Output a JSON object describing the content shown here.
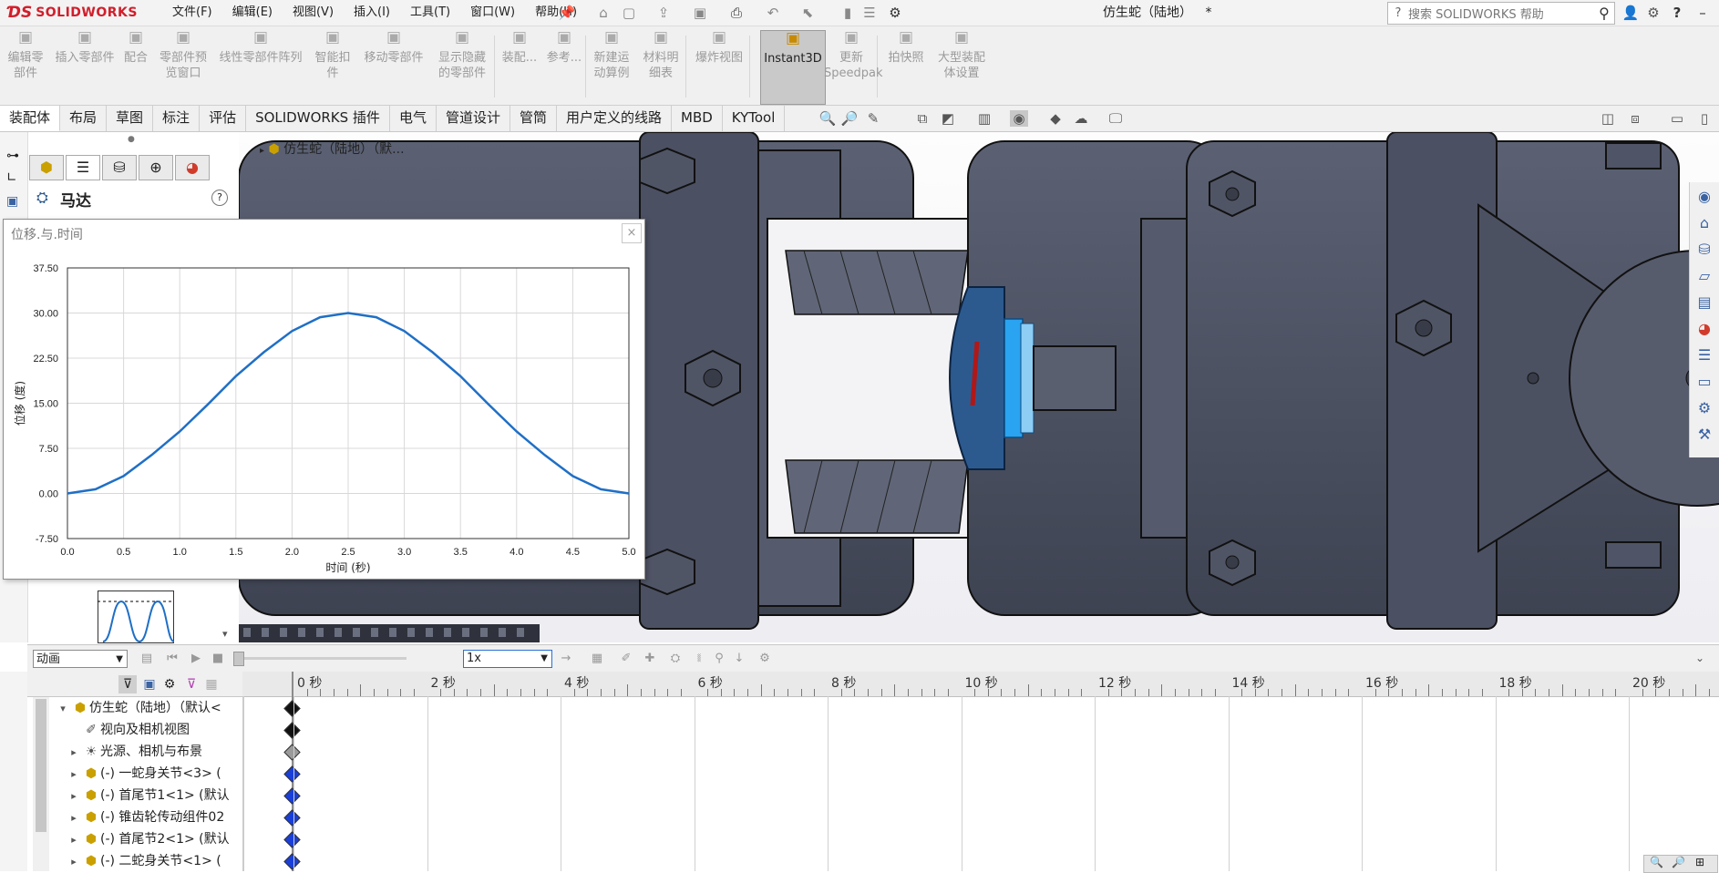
{
  "app": {
    "brand": "SOLIDWORKS",
    "document_title": "仿生蛇（陆地）",
    "modified_marker": "*",
    "menus": [
      "文件(F)",
      "编辑(E)",
      "视图(V)",
      "插入(I)",
      "工具(T)",
      "窗口(W)",
      "帮助(H)"
    ],
    "search_placeholder": "搜索 SOLIDWORKS 帮助"
  },
  "command_manager": [
    {
      "label": "编辑零\n部件",
      "icon": "edit-component-icon",
      "enabled": false
    },
    {
      "label": "插入零部件",
      "icon": "insert-component-icon",
      "enabled": false
    },
    {
      "label": "配合",
      "icon": "mate-icon",
      "enabled": false
    },
    {
      "label": "零部件预\n览窗口",
      "icon": "preview-window-icon",
      "enabled": false
    },
    {
      "label": "线性零部件阵列",
      "icon": "pattern-icon",
      "enabled": false
    },
    {
      "label": "智能扣\n件",
      "icon": "smart-fastener-icon",
      "enabled": false
    },
    {
      "label": "移动零部件",
      "icon": "move-component-icon",
      "enabled": false
    },
    {
      "label": "显示隐藏\n的零部件",
      "icon": "show-hidden-icon",
      "enabled": false
    },
    {
      "label": "装配...",
      "icon": "assembly-feature-icon",
      "enabled": false
    },
    {
      "label": "参考...",
      "icon": "reference-geometry-icon",
      "enabled": false
    },
    {
      "label": "新建运\n动算例",
      "icon": "new-motion-study-icon",
      "enabled": false
    },
    {
      "label": "材料明\n细表",
      "icon": "bom-icon",
      "enabled": false
    },
    {
      "label": "爆炸视图",
      "icon": "exploded-view-icon",
      "enabled": false
    },
    {
      "label": "Instant3D",
      "icon": "instant3d-icon",
      "enabled": true
    },
    {
      "label": "更新\nSpeedpak",
      "icon": "speedpak-icon",
      "enabled": false
    },
    {
      "label": "拍快照",
      "icon": "snapshot-icon",
      "enabled": false
    },
    {
      "label": "大型装配\n体设置",
      "icon": "large-assembly-icon",
      "enabled": false
    }
  ],
  "tabs": [
    "装配体",
    "布局",
    "草图",
    "标注",
    "评估",
    "SOLIDWORKS 插件",
    "电气",
    "管道设计",
    "管筒",
    "用户定义的线路",
    "MBD",
    "KYTool"
  ],
  "property_manager": {
    "title": "马达",
    "help": "?"
  },
  "feature_tree_head": "仿生蛇（陆地）（默...",
  "graph": {
    "window_title": "位移.与.时间",
    "close": "×"
  },
  "chart_data": {
    "type": "line",
    "xlabel": "时间 (秒)",
    "ylabel": "位移 (度)",
    "xlim": [
      0.0,
      5.0
    ],
    "ylim": [
      -7.5,
      37.5
    ],
    "x_ticks": [
      "0.0",
      "0.5",
      "1.0",
      "1.5",
      "2.0",
      "2.5",
      "3.0",
      "3.5",
      "4.0",
      "4.5",
      "5.0"
    ],
    "y_ticks": [
      "37.50",
      "30.00",
      "22.50",
      "15.00",
      "7.50",
      "0.00",
      "-7.50"
    ],
    "grid": true,
    "line_color": "#1f6fc6",
    "x": [
      0,
      0.25,
      0.5,
      0.75,
      1.0,
      1.25,
      1.5,
      1.75,
      2.0,
      2.25,
      2.5,
      2.75,
      3.0,
      3.25,
      3.5,
      3.75,
      4.0,
      4.25,
      4.5,
      4.75,
      5.0
    ],
    "y": [
      0.0,
      0.7,
      2.9,
      6.4,
      10.3,
      14.8,
      19.5,
      23.5,
      27.0,
      29.3,
      30.0,
      29.3,
      27.0,
      23.5,
      19.5,
      14.8,
      10.3,
      6.4,
      2.9,
      0.7,
      0.0
    ]
  },
  "motion_manager": {
    "study_type": "动画",
    "playback_speed": "1x",
    "time_labels": [
      "0 秒",
      "2 秒",
      "4 秒",
      "6 秒",
      "8 秒",
      "10 秒",
      "12 秒",
      "14 秒",
      "16 秒",
      "18 秒",
      "20 秒"
    ],
    "tree": [
      {
        "label": "仿生蛇（陆地）（默认<",
        "expand": "▾",
        "icon": "assembly-icon",
        "key_color": "#111111"
      },
      {
        "label": "视向及相机视图",
        "expand": "",
        "icon": "camera-view-icon",
        "key_color": "#111111"
      },
      {
        "label": "光源、相机与布景",
        "expand": "▸",
        "icon": "lights-icon",
        "key_color": "#9a9a9a"
      },
      {
        "label": "(-) 一蛇身关节<3> (",
        "expand": "▸",
        "icon": "subassembly-icon",
        "key_color": "#1a3fd8"
      },
      {
        "label": "(-) 首尾节1<1> (默认",
        "expand": "▸",
        "icon": "subassembly-icon",
        "key_color": "#1a3fd8"
      },
      {
        "label": "(-) 锥齿轮传动组件02",
        "expand": "▸",
        "icon": "subassembly-icon",
        "key_color": "#1a3fd8"
      },
      {
        "label": "(-) 首尾节2<1> (默认",
        "expand": "▸",
        "icon": "subassembly-icon",
        "key_color": "#1a3fd8"
      },
      {
        "label": "(-) 二蛇身关节<1> (",
        "expand": "▸",
        "icon": "subassembly-icon",
        "key_color": "#1a3fd8"
      }
    ]
  },
  "colors": {
    "brand_red": "#d21e2b",
    "accent_blue": "#2a6fd8",
    "model_gray": "#4a5061",
    "gear_blue": "#2c5a8f"
  }
}
